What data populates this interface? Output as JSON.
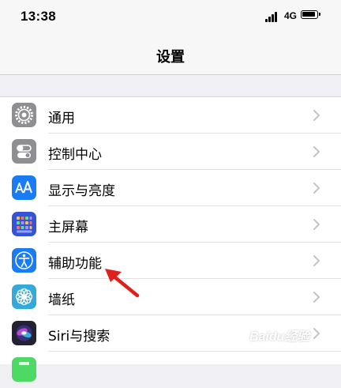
{
  "status_bar": {
    "time": "13:38",
    "network": "4G"
  },
  "nav": {
    "title": "设置"
  },
  "settings": [
    {
      "label": "通用",
      "icon": "gear-icon",
      "color": "#8e8e93"
    },
    {
      "label": "控制中心",
      "icon": "toggles-icon",
      "color": "#8e8e93"
    },
    {
      "label": "显示与亮度",
      "icon": "text-size-icon",
      "color": "#1a7cf5"
    },
    {
      "label": "主屏幕",
      "icon": "app-grid-icon",
      "color": "#3553d6"
    },
    {
      "label": "辅助功能",
      "icon": "accessibility-icon",
      "color": "#1a7cf5"
    },
    {
      "label": "墙纸",
      "icon": "flower-icon",
      "color": "#34aadc"
    },
    {
      "label": "Siri与搜索",
      "icon": "siri-icon",
      "color": "#222232"
    },
    {
      "label": "",
      "icon": "partial-icon",
      "color": "#4cd964"
    }
  ],
  "watermark": "Baidu经验",
  "annotation": {
    "color": "#e0201b"
  }
}
